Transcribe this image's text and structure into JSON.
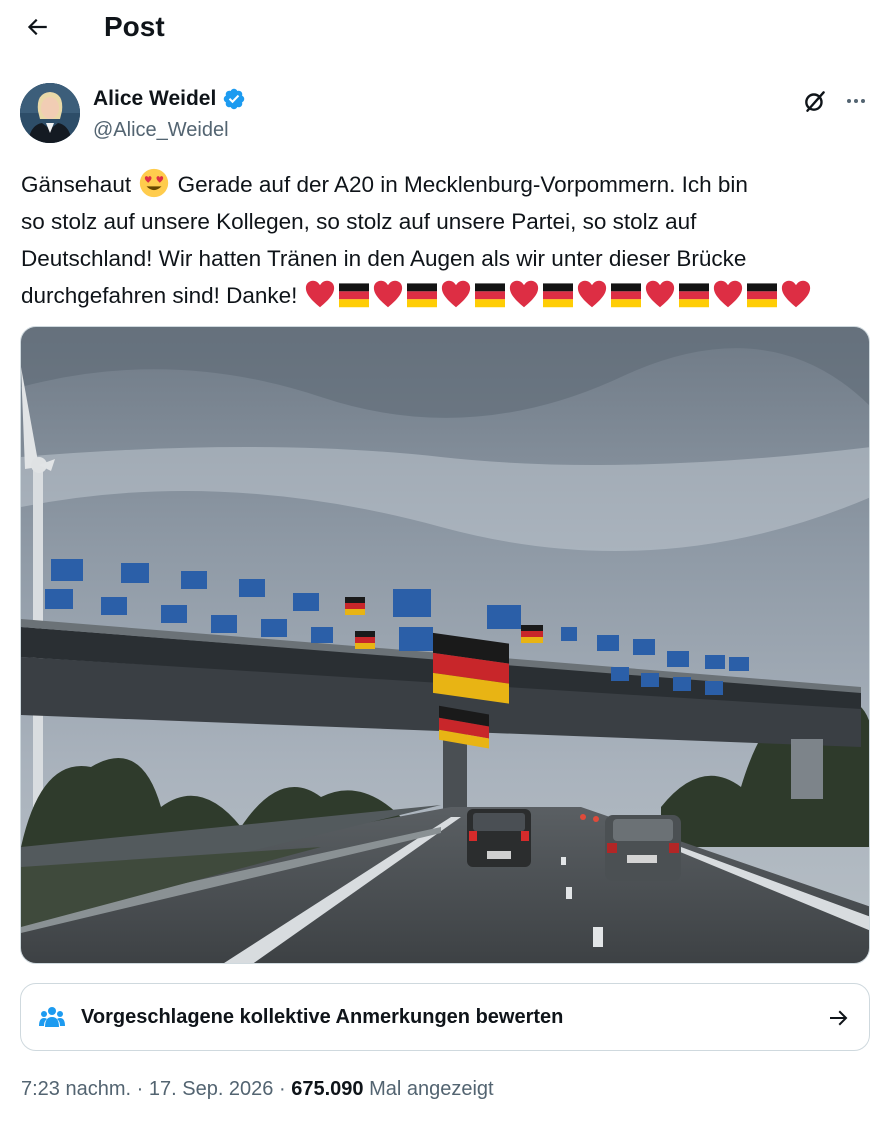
{
  "header": {
    "back_icon": "arrow-left-icon",
    "title": "Post"
  },
  "author": {
    "name": "Alice Weidel",
    "handle": "@Alice_Weidel",
    "verified_icon": "verified-badge-icon",
    "verified_color": "#1d9bf0"
  },
  "actions": {
    "grok_icon": "grok-icon",
    "more_icon": "more-horizontal-icon"
  },
  "post": {
    "line1_before_emoji": "Gänsehaut",
    "line1_emoji": "smiling-face-with-heart-eyes",
    "line1_after_emoji": "Gerade auf der A20 in Mecklenburg-Vorpommern. Ich bin",
    "line2": "so stolz auf unsere Kollegen, so stolz auf unsere Partei, so stolz auf",
    "line3": "Deutschland! Wir hatten Tränen in den Augen als wir unter dieser Brücke",
    "line4_text": "durchgefahren sind! Danke!",
    "line4_emojis": [
      "heart",
      "flag-de",
      "heart",
      "flag-de",
      "heart",
      "flag-de",
      "heart",
      "flag-de",
      "heart",
      "flag-de",
      "heart",
      "flag-de",
      "heart",
      "flag-de",
      "heart"
    ]
  },
  "media": {
    "type": "photo"
  },
  "community_notes": {
    "icon": "people-icon",
    "label": "Vorgeschlagene kollektive Anmerkungen bewerten",
    "arrow_icon": "arrow-right-icon"
  },
  "meta": {
    "time": "7:23 nachm.",
    "separator": "·",
    "date": "17. Sep. 2026",
    "views": "675.090",
    "views_label": "Mal angezeigt"
  },
  "colors": {
    "text_primary": "#0f1419",
    "text_secondary": "#536471",
    "border": "#cfd9de",
    "accent": "#1d9bf0"
  }
}
